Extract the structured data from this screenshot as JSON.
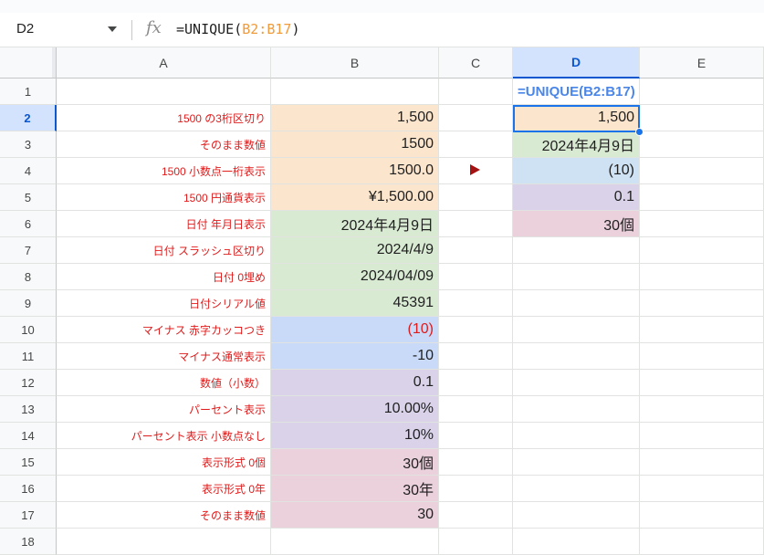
{
  "formula_bar": {
    "name_box": "D2",
    "fx_label": "fx",
    "formula_prefix": "=UNIQUE(",
    "formula_range": "B2:B17",
    "formula_suffix": ")"
  },
  "columns": [
    "A",
    "B",
    "C",
    "D",
    "E"
  ],
  "rows": [
    "1",
    "2",
    "3",
    "4",
    "5",
    "6",
    "7",
    "8",
    "9",
    "10",
    "11",
    "12",
    "13",
    "14",
    "15",
    "16",
    "17",
    "18"
  ],
  "column_a": [
    "",
    "1500 の3桁区切り",
    "そのまま数値",
    "1500 小数点一桁表示",
    "1500 円通貨表示",
    "日付 年月日表示",
    "日付 スラッシュ区切り",
    "日付 0埋め",
    "日付シリアル値",
    "マイナス 赤字カッコつき",
    "マイナス通常表示",
    "数値（小数）",
    "パーセント表示",
    "パーセント表示 小数点なし",
    "表示形式 0個",
    "表示形式 0年",
    "そのまま数値"
  ],
  "column_b": [
    "",
    "1,500",
    "1500",
    "1500.0",
    "¥1,500.00",
    "2024年4月9日",
    "2024/4/9",
    "2024/04/09",
    "45391",
    "(10)",
    "-10",
    "0.1",
    "10.00%",
    "10%",
    "30個",
    "30年",
    "30"
  ],
  "column_d": [
    "=UNIQUE(B2:B17)",
    "1,500",
    "2024年4月9日",
    "(10)",
    "0.1",
    "30個"
  ],
  "colors": {
    "orange": "#fce5cd",
    "green": "#d9ead3",
    "blue": "#c9daf8",
    "light_blue": "#cfe2f3",
    "purple": "#d9d2e9",
    "pink": "#ead1dc",
    "label_red": "#e01b1b",
    "selection": "#1a73e8"
  },
  "icons": {
    "arrow": "play-arrow-icon",
    "dropdown": "chevron-down-icon",
    "fx": "function-icon"
  }
}
